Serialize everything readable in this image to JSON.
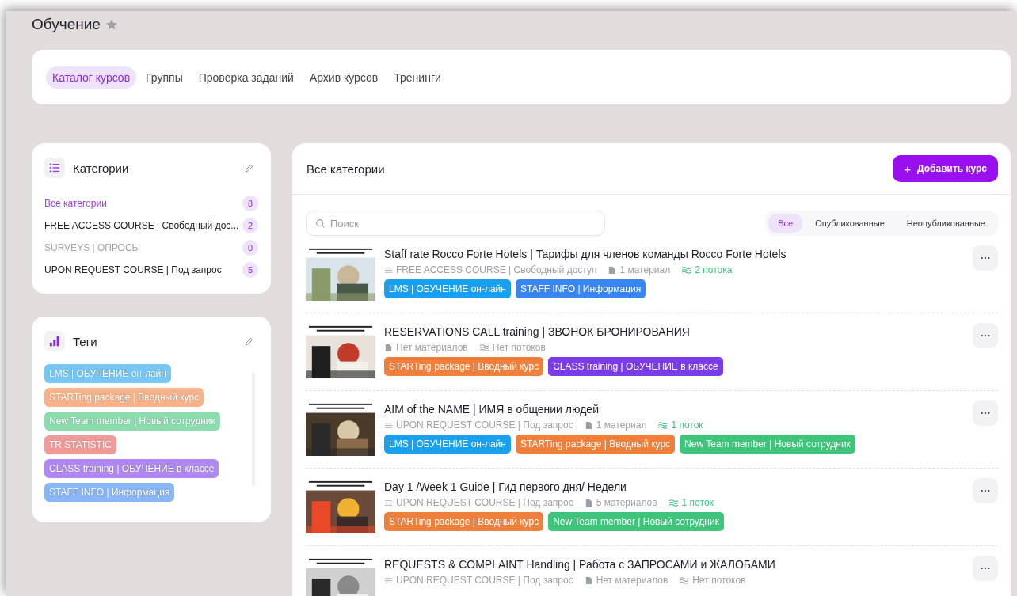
{
  "page": {
    "title": "Обучение",
    "favorite": false
  },
  "tabs": [
    {
      "label": "Каталог курсов",
      "selected": true
    },
    {
      "label": "Группы",
      "selected": false
    },
    {
      "label": "Проверка заданий",
      "selected": false
    },
    {
      "label": "Архив курсов",
      "selected": false
    },
    {
      "label": "Тренинги",
      "selected": false
    }
  ],
  "categories": {
    "title": "Категории",
    "items": [
      {
        "label": "Все категории",
        "count": "8",
        "selected": true,
        "muted": false
      },
      {
        "label": "FREE ACCESS COURSE | Свободный дос...",
        "count": "2",
        "selected": false,
        "muted": false
      },
      {
        "label": "SURVEYS | ОПРОСЫ",
        "count": "0",
        "selected": false,
        "muted": true
      },
      {
        "label": "UPON REQUEST COURSE | Под запрос",
        "count": "5",
        "selected": false,
        "muted": false
      }
    ]
  },
  "tags": {
    "title": "Теги",
    "items": [
      {
        "label": "LMS | ОБУЧЕНИЕ он-лайн",
        "color": "#76c6f6"
      },
      {
        "label": "STARTing package | Вводный курс",
        "color": "#f6b28a"
      },
      {
        "label": "New Team member | Новый сотрудник",
        "color": "#8cdcb0"
      },
      {
        "label": "TR STATISTIC",
        "color": "#f09a9a"
      },
      {
        "label": "CLASS training | ОБУЧЕНИЕ в классе",
        "color": "#af89f1"
      },
      {
        "label": "STAFF INFO | Информация",
        "color": "#89b6f6"
      }
    ]
  },
  "main": {
    "title": "Все категории",
    "add_button": "Добавить курс",
    "add_icon": "+",
    "search": {
      "placeholder": "Поиск"
    },
    "filters": [
      {
        "label": "Все",
        "selected": true
      },
      {
        "label": "Опубликованные",
        "selected": false
      },
      {
        "label": "Неопубликованные",
        "selected": false
      }
    ],
    "courses": [
      {
        "kind": "picture",
        "title": "Staff rate Rocco Forte Hotels | Тарифы для членов команды Rocco Forte Hotels",
        "category": "FREE ACCESS COURSE | Свободный доступ",
        "materials": "1 материал",
        "streams": "2 потока",
        "has_streams": true,
        "tags": [
          {
            "label": "LMS | ОБУЧЕНИЕ он-лайн",
            "color": "#1aa0f0"
          },
          {
            "label": "STAFF INFO | Информация",
            "color": "#3a86f0"
          }
        ]
      },
      {
        "kind": "picture",
        "title": "RESERVATIONS CALL training | ЗВОНОК БРОНИРОВАНИЯ",
        "materials": "Нет материалов",
        "streams": "Нет потоков",
        "has_streams": false,
        "tags": [
          {
            "label": "STARTing package | Вводный курс",
            "color": "#f07f3c"
          },
          {
            "label": "CLASS training | ОБУЧЕНИЕ в классе",
            "color": "#7a3be8"
          }
        ]
      },
      {
        "kind": "picture",
        "title": "AIM of the NAME | ИМЯ в общении людей",
        "category": "UPON REQUEST COURSE | Под запрос",
        "materials": "1 материал",
        "streams": "1 поток",
        "has_streams": true,
        "tags": [
          {
            "label": "LMS | ОБУЧЕНИЕ он-лайн",
            "color": "#1aa0f0"
          },
          {
            "label": "STARTing package | Вводный курс",
            "color": "#f07f3c"
          },
          {
            "label": "New Team member | Новый сотрудник",
            "color": "#3fc47c"
          }
        ]
      },
      {
        "kind": "picture",
        "title": "Day 1 /Week 1 Guide | Гид первого дня/ Недели",
        "category": "UPON REQUEST COURSE | Под запрос",
        "materials": "5 материалов",
        "streams": "1 поток",
        "has_streams": true,
        "tags": [
          {
            "label": "STARTing package | Вводный курс",
            "color": "#f07f3c"
          },
          {
            "label": "New Team member | Новый сотрудник",
            "color": "#3fc47c"
          }
        ]
      },
      {
        "kind": "picture",
        "title": "REQUESTS & COMPLAINT Handling | Работа с ЗАПРОСАМИ и ЖАЛОБАМИ",
        "category": "UPON REQUEST COURSE | Под запрос",
        "materials": "Нет материалов",
        "streams": "Нет потоков",
        "has_streams": false
      }
    ]
  }
}
